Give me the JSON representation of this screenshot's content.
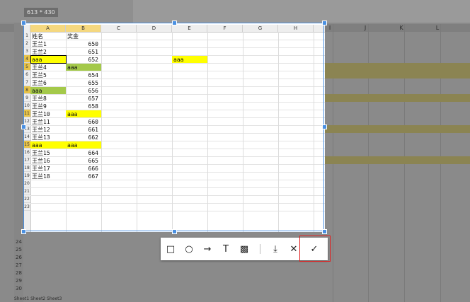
{
  "capture": {
    "size_label": "613 * 430"
  },
  "dim_columns": [
    "I",
    "J",
    "K",
    "L"
  ],
  "dim_rows": [
    "24",
    "25",
    "26",
    "27",
    "28",
    "29",
    "30"
  ],
  "sheet": {
    "columns": [
      "A",
      "B",
      "C",
      "D",
      "E",
      "F",
      "G",
      "H"
    ],
    "row_numbers": [
      "1",
      "2",
      "3",
      "4",
      "5",
      "6",
      "7",
      "8",
      "9",
      "10",
      "11",
      "12",
      "13",
      "14",
      "15",
      "16",
      "17",
      "18",
      "19",
      "20",
      "21",
      "22",
      "23"
    ],
    "highlight_rows": [
      4,
      5,
      8,
      11,
      15
    ],
    "rows": [
      {
        "a": "姓名",
        "b": ""
      },
      {
        "a": "王兰1",
        "b": "650"
      },
      {
        "a": "王兰2",
        "b": "651"
      },
      {
        "a": "aaa",
        "b": "652"
      },
      {
        "a": "王兰4",
        "b": "aaa"
      },
      {
        "a": "王兰5",
        "b": "654"
      },
      {
        "a": "王兰6",
        "b": "655"
      },
      {
        "a": "aaa",
        "b": "656"
      },
      {
        "a": "王兰8",
        "b": "657"
      },
      {
        "a": "王兰9",
        "b": "658"
      },
      {
        "a": "王兰10",
        "b": "aaa"
      },
      {
        "a": "王兰11",
        "b": "660"
      },
      {
        "a": "王兰12",
        "b": "661"
      },
      {
        "a": "王兰13",
        "b": "662"
      },
      {
        "a": "aaa",
        "b": "aaa"
      },
      {
        "a": "王兰15",
        "b": "664"
      },
      {
        "a": "王兰16",
        "b": "665"
      },
      {
        "a": "王兰17",
        "b": "666"
      },
      {
        "a": "王兰18",
        "b": "667"
      }
    ],
    "header_b": "奖金",
    "e4_value": "aaa"
  },
  "toolbar": {
    "tools": [
      {
        "name": "rectangle-tool",
        "glyph": "□"
      },
      {
        "name": "ellipse-tool",
        "glyph": "○"
      },
      {
        "name": "arrow-tool",
        "glyph": "→"
      },
      {
        "name": "text-tool",
        "glyph": "T"
      },
      {
        "name": "mosaic-tool",
        "glyph": "▩"
      },
      {
        "name": "save-tool",
        "glyph": "⤓"
      },
      {
        "name": "cancel-tool",
        "glyph": "✕"
      },
      {
        "name": "confirm-tool",
        "glyph": "✓"
      }
    ]
  },
  "colors": {
    "selection_border": "#4a90e2",
    "highlight_yellow": "#ffff00",
    "highlight_green": "#a4c94a",
    "confirm_outline": "#e02020"
  },
  "sheet_tabs": "Sheet1  Sheet2  Sheet3"
}
